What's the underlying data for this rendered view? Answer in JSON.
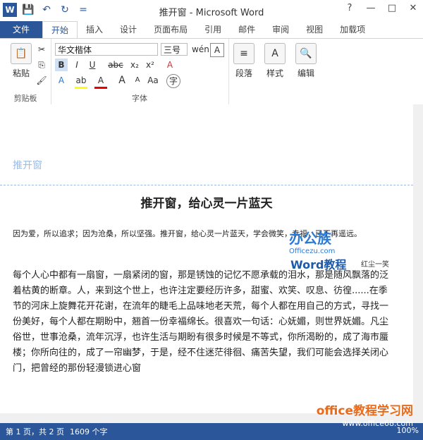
{
  "window": {
    "title": "推开窗 - Microsoft Word",
    "help_label": "?",
    "minimize_label": "—",
    "restore_label": "□",
    "close_label": "✕"
  },
  "quick_access": {
    "word_icon_letter": "W",
    "save_symbol": "💾",
    "undo_symbol": "↶",
    "redo_symbol": "↻",
    "customize_symbol": "="
  },
  "tabs": [
    {
      "label": "文件"
    },
    {
      "label": "开始"
    },
    {
      "label": "插入"
    },
    {
      "label": "设计"
    },
    {
      "label": "页面布局"
    },
    {
      "label": "引用"
    },
    {
      "label": "邮件"
    },
    {
      "label": "审阅"
    },
    {
      "label": "视图"
    },
    {
      "label": "加载项"
    }
  ],
  "ribbon": {
    "clipboard": {
      "label": "剪贴板",
      "paste_label": "粘贴"
    },
    "font": {
      "label": "字体",
      "font_name": "华文楷体",
      "font_size": "三号",
      "bold": "B",
      "italic": "I",
      "underline": "U",
      "strikethrough": "abc",
      "subscript": "x₂",
      "superscript": "x²"
    },
    "paragraph": {
      "label": "段落"
    },
    "styles": {
      "label": "样式"
    },
    "editing": {
      "label": "编辑"
    }
  },
  "document": {
    "header_text": "推开窗",
    "title": "推开窗，给心灵一片蓝天",
    "intro": "因为爱，所以追求；因为沧桑，所以坚强。推开窗，给心灵一片蓝天，学会微笑，幸福，已不再遥远。",
    "body": "每个人心中都有一扇窗，一扇紧闭的窗，那是锈蚀的记忆不愿承载的泪水，那是随风飘落的泛着枯黄的断章。人，来到这个世上，也许注定要经历许多，甜蜜、欢笑、叹息、彷徨......在季节的河床上旋舞花开花谢，在流年的睫毛上品味地老天荒，每个人都在用自己的方式，寻找一份美好，每个人都在期盼中，翘首一份幸福绵长。很喜欢一句话：心妩媚，则世界妩媚。凡尘俗世，世事沧桑，流年沉浮，也许生活与期盼有很多时候是不等式，你所渴盼的，成了海市蜃楼；你所向往的，成了一帘幽梦，于是，经不住迷茫徘徊、痛苦失望，我们可能会选择关闭心门，把曾经的那份轻漫锁进心窗",
    "author": "红尘一笑"
  },
  "watermark": {
    "site_cn": "办公族",
    "site_en": "Officezu.com",
    "label": "Word教程"
  },
  "status": {
    "page": "第 1 页，共 2 页",
    "words": "1609 个字",
    "zoom": "100%"
  },
  "brand": {
    "name": "office教程学习网",
    "url": "www.office68.com"
  }
}
